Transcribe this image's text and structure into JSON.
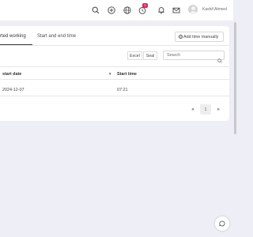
{
  "header": {
    "icons": [
      "search-icon",
      "add-circle-icon",
      "globe-icon",
      "timer-icon",
      "bell-icon",
      "mail-icon"
    ],
    "notification_count": "0",
    "user_name": "Kashif Ahmed"
  },
  "tabs": [
    {
      "label": "rted working",
      "active": true
    },
    {
      "label": "Start and end time",
      "active": false
    }
  ],
  "toolbar": {
    "add_time_label": "Add time manually",
    "excel_label": "Excel",
    "seal_label": "Seal",
    "search_placeholder": "Search"
  },
  "table": {
    "columns": [
      "start date",
      "Start time"
    ],
    "rows": [
      {
        "start_date": "2024-12-07",
        "start_time": "07:21"
      }
    ]
  },
  "pagination": {
    "prev_label": "«",
    "current_page": "1",
    "next_label": "»"
  },
  "colors": {
    "background": "#eeeef6",
    "card": "#ffffff",
    "badge": "#e0245e"
  }
}
